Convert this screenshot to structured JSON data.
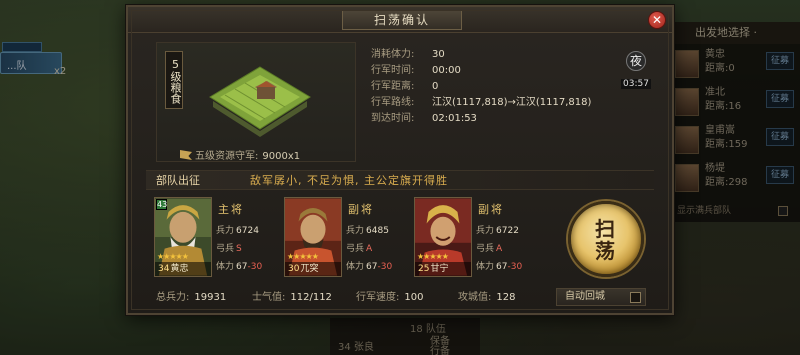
{
  "background": {
    "unit_label": "...队",
    "unit_count": "x2",
    "side_panel": {
      "title": "出发地选择 ·",
      "rows": [
        {
          "name": "黄忠",
          "distance_label": "距离",
          "distance": "0",
          "button": "征募"
        },
        {
          "name": "准北",
          "distance_label": "距离",
          "distance": "16",
          "button": "征募"
        },
        {
          "name": "皇甫嵩",
          "distance_label": "距离",
          "distance": "159",
          "button": "征募"
        },
        {
          "name": "杨堤",
          "distance_label": "距离",
          "distance": "298",
          "button": "征募"
        }
      ],
      "footer": "显示满兵部队"
    },
    "bottom_strip": {
      "a": "34 张良",
      "b": "18 队伍",
      "c": "保备",
      "d": "行备"
    }
  },
  "dialog": {
    "title": "扫荡确认",
    "close": "✕",
    "target": {
      "badge": "5级粮食",
      "resource_label": "五级资源守军:",
      "resource_value": "9000x1"
    },
    "info": [
      {
        "label": "消耗体力:",
        "value": "30"
      },
      {
        "label": "行军时间:",
        "value": "00:00"
      },
      {
        "label": "行军距离:",
        "value": "0"
      },
      {
        "label": "行军路线:",
        "value": "江汉(1117,818)→江汉(1117,818)"
      },
      {
        "label": "到达时间:",
        "value": "02:01:53"
      }
    ],
    "night": {
      "icon": "夜",
      "time": "03:57"
    },
    "troops": {
      "title": "部队出征",
      "quote": "敌军孱小, 不足为惧, 主公定旗开得胜"
    },
    "generals": [
      {
        "role": "主将",
        "tag": "43",
        "level": "34",
        "name": "黄忠",
        "troops_label": "兵力",
        "troops": "6724",
        "arm_label": "弓兵",
        "grade": "S",
        "stamina_label": "体力",
        "stamina": "67",
        "stamina_cost": "-30",
        "stars": "★★★★★"
      },
      {
        "role": "副将",
        "tag": "",
        "level": "30",
        "name": "兀突",
        "troops_label": "兵力",
        "troops": "6485",
        "arm_label": "弓兵",
        "grade": "A",
        "stamina_label": "体力",
        "stamina": "67",
        "stamina_cost": "-30",
        "stars": "★★★★★"
      },
      {
        "role": "副将",
        "tag": "",
        "level": "25",
        "name": "甘宁",
        "troops_label": "兵力",
        "troops": "6722",
        "arm_label": "弓兵",
        "grade": "A",
        "stamina_label": "体力",
        "stamina": "67",
        "stamina_cost": "-30",
        "stars": "★★★★★"
      }
    ],
    "sweep_button": {
      "line1": "扫",
      "line2": "荡"
    },
    "stats": [
      {
        "label": "总兵力:",
        "value": "19931"
      },
      {
        "label": "士气值:",
        "value": "112/112"
      },
      {
        "label": "行军速度:",
        "value": "100"
      },
      {
        "label": "攻城值:",
        "value": "128"
      }
    ],
    "auto_return": {
      "label": "自动回城",
      "checked": false
    }
  },
  "colors": {
    "gold": "#e4c36f",
    "accent_red": "#e76052",
    "close_red": "#c0392b",
    "panel": "#1f1c18"
  }
}
